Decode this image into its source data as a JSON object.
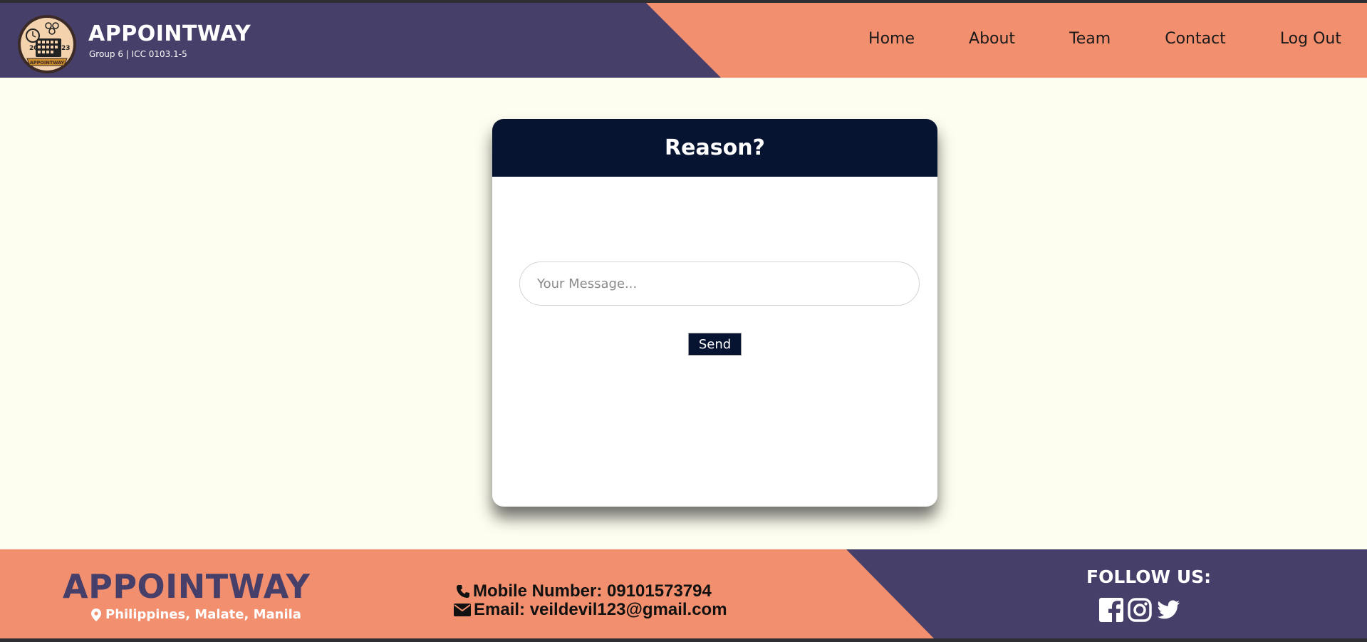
{
  "header": {
    "brand_title": "APPOINTWAY",
    "brand_subtitle": "Group 6 | ICC 0103.1-5",
    "logo": {
      "year_left": "20",
      "year_right": "23",
      "ribbon": "APPOINTWAY"
    },
    "nav": [
      {
        "label": "Home"
      },
      {
        "label": "About"
      },
      {
        "label": "Team"
      },
      {
        "label": "Contact"
      },
      {
        "label": "Log Out"
      }
    ]
  },
  "card": {
    "title": "Reason?",
    "message_placeholder": "Your Message...",
    "message_value": "",
    "send_label": "Send"
  },
  "footer": {
    "brand": "APPOINTWAY",
    "location": "Philippines, Malate, Manila",
    "phone": "Mobile Number: 09101573794",
    "email": "Email: veildevil123@gmail.com",
    "follow_title": "FOLLOW US:",
    "social_icons": [
      "facebook-icon",
      "instagram-icon",
      "twitter-icon"
    ]
  },
  "colors": {
    "purple": "#463f69",
    "salmon": "#f28f6e",
    "navy": "#071431",
    "cream": "#fefef0"
  }
}
